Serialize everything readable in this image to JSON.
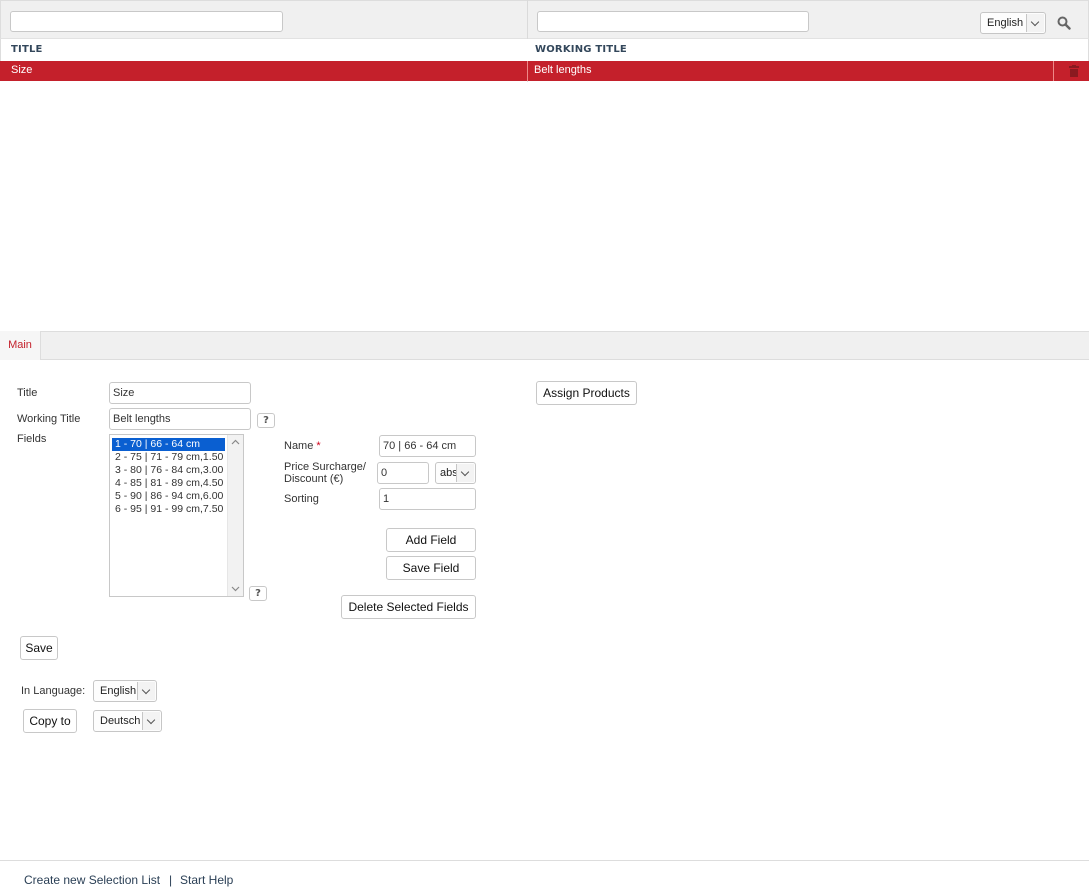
{
  "list": {
    "language_filter": "English",
    "columns": {
      "title": "TITLE",
      "working_title": "WORKING TITLE"
    },
    "rows": [
      {
        "title": "Size",
        "working_title": "Belt lengths"
      }
    ]
  },
  "tabs": {
    "main": "Main"
  },
  "form": {
    "title_label": "Title",
    "title_value": "Size",
    "working_title_label": "Working Title",
    "working_title_value": "Belt lengths",
    "fields_label": "Fields",
    "fields_list": [
      "1 - 70 | 66 - 64 cm",
      "2 - 75 | 71 - 79 cm,1.50",
      "3 - 80 | 76 - 84 cm,3.00",
      "4 - 85 | 81 - 89 cm,4.50",
      "5 - 90 | 86 - 94 cm,6.00",
      "6 - 95 | 91 - 99 cm,7.50"
    ],
    "help_glyph": "?",
    "name_label": "Name",
    "required_mark": "*",
    "name_value": "70 | 66 - 64 cm",
    "price_label_1": "Price Surcharge/",
    "price_label_2": "Discount (€)",
    "price_value": "0",
    "price_type": "abs",
    "sorting_label": "Sorting",
    "sorting_value": "1",
    "add_field": "Add Field",
    "save_field": "Save Field",
    "delete_fields": "Delete Selected Fields",
    "assign_products": "Assign Products",
    "save": "Save",
    "in_language_label": "In Language:",
    "in_language_value": "English",
    "copy_to": "Copy to",
    "copy_language_value": "Deutsch"
  },
  "footer": {
    "create_link": "Create new Selection List",
    "separator": "|",
    "help_link": "Start Help"
  },
  "colors": {
    "accent": "#c4202b",
    "selection": "#0a5fd1"
  }
}
